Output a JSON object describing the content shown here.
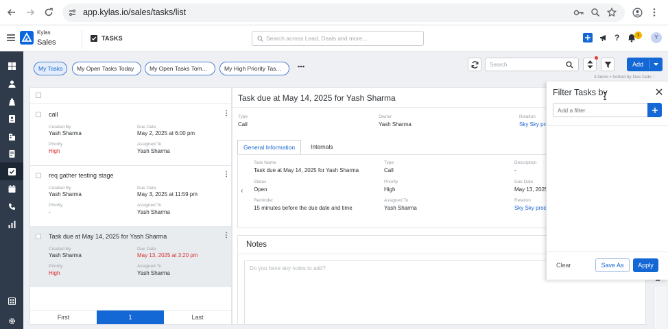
{
  "browser": {
    "url": "app.kylas.io/sales/tasks/list"
  },
  "app": {
    "brand_top": "Kylas",
    "brand_bottom": "Sales",
    "section_title": "TASKS",
    "global_search_placeholder": "Search across Lead, Deals and more...",
    "notification_count": "1",
    "avatar_initial": "Y"
  },
  "filters": [
    "My Tasks",
    "My Open Tasks Today",
    "My Open Tasks Tom...",
    "My High Priority Tas..."
  ],
  "toolbar": {
    "search_placeholder": "Search",
    "add_label": "Add",
    "meta_text": "3 items • Sorted by  Due Date ↑"
  },
  "labels": {
    "created_by": "Created By",
    "due_date": "Due Date",
    "priority": "Priority",
    "assigned_to": "Assigned To"
  },
  "tasks": [
    {
      "title": "call",
      "created_by": "Yash Sharma",
      "due_date": "May 2, 2025 at 6:00 pm",
      "priority": "High",
      "assigned_to": "Yash Sharma"
    },
    {
      "title": "req gather testing stage",
      "created_by": "Yash Sharma",
      "due_date": "May 3, 2025 at 11:59 pm",
      "priority": "-",
      "assigned_to": "Yash Sharma"
    },
    {
      "title": "Task due at May 14, 2025 for Yash Sharma",
      "created_by": "Yash Sharma",
      "due_date": "May 13, 2025 at 3:20 pm",
      "priority": "High",
      "assigned_to": "Yash Sharma"
    }
  ],
  "pager": {
    "first": "First",
    "current": "1",
    "last": "Last"
  },
  "detail": {
    "title": "Task due at May 14, 2025 for Yash Sharma",
    "type_label": "Type",
    "type_value": "Call",
    "owner_label": "Owner",
    "owner_value": "Yash Sharma",
    "relation_label": "Relation",
    "relation_value": "Sky Sky pro",
    "tabs": [
      "General Information",
      "Internals"
    ],
    "gi": {
      "task_name_label": "Task Name",
      "task_name": "Task due at May 14, 2025 for Yash Sharma",
      "type_label": "Type",
      "type": "Call",
      "description_label": "Description",
      "description": "-",
      "status_label": "Status",
      "status": "Open",
      "priority_label": "Priority",
      "priority": "High",
      "due_date_label": "Due Date",
      "due_date": "May 13, 2025",
      "reminder_label": "Reminder",
      "reminder": "15 minutes before the due date and time",
      "assigned_label": "Assigned To",
      "assigned": "Yash Sharma",
      "relation_label": "Relation",
      "relation": "Sky Sky prod"
    },
    "notes_title": "Notes",
    "notes_placeholder": "Do you have any notes to add?"
  },
  "filter_panel": {
    "title": "Filter Tasks by",
    "input_placeholder": "Add a filter",
    "clear": "Clear",
    "save_as": "Save As",
    "apply": "Apply"
  }
}
